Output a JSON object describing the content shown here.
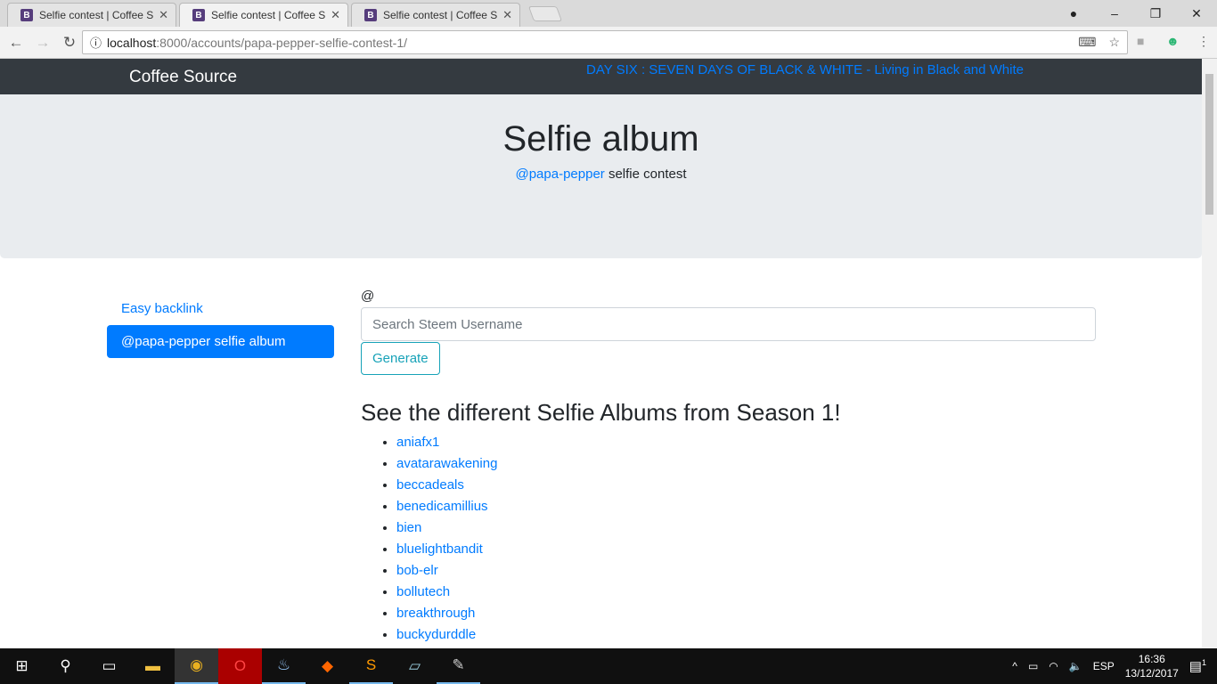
{
  "browser": {
    "tabs": [
      {
        "title": "Selfie contest | Coffee So",
        "active": false
      },
      {
        "title": "Selfie contest | Coffee So",
        "active": true
      },
      {
        "title": "Selfie contest | Coffee So",
        "active": false
      }
    ],
    "url_host": "localhost",
    "url_rest": ":8000/accounts/papa-pepper-selfie-contest-1/"
  },
  "navbar": {
    "brand": "Coffee Source",
    "link": "DAY SIX : SEVEN DAYS OF BLACK & WHITE - Living in Black and White"
  },
  "jumbotron": {
    "title": "Selfie album",
    "user_link": "@papa-pepper",
    "subtitle": " selfie contest"
  },
  "sidebar": {
    "items": [
      {
        "label": "Easy backlink",
        "active": false
      },
      {
        "label": "@papa-pepper selfie album",
        "active": true
      }
    ]
  },
  "form": {
    "prefix": "@",
    "placeholder": "Search Steem Username",
    "button": "Generate"
  },
  "albums": {
    "heading": "See the different Selfie Albums from Season 1!",
    "items": [
      "aniafx1",
      "avatarawakening",
      "beccadeals",
      "benedicamillius",
      "bien",
      "bluelightbandit",
      "bob-elr",
      "bollutech",
      "breakthrough",
      "buckydurddle"
    ]
  },
  "taskbar": {
    "lang": "ESP",
    "time": "16:36",
    "date": "13/12/2017",
    "notifications": "1"
  },
  "colors": {
    "primary": "#007bff",
    "navbar": "#343a40",
    "jumbotron": "#e9ecef",
    "info": "#17a2b8"
  }
}
